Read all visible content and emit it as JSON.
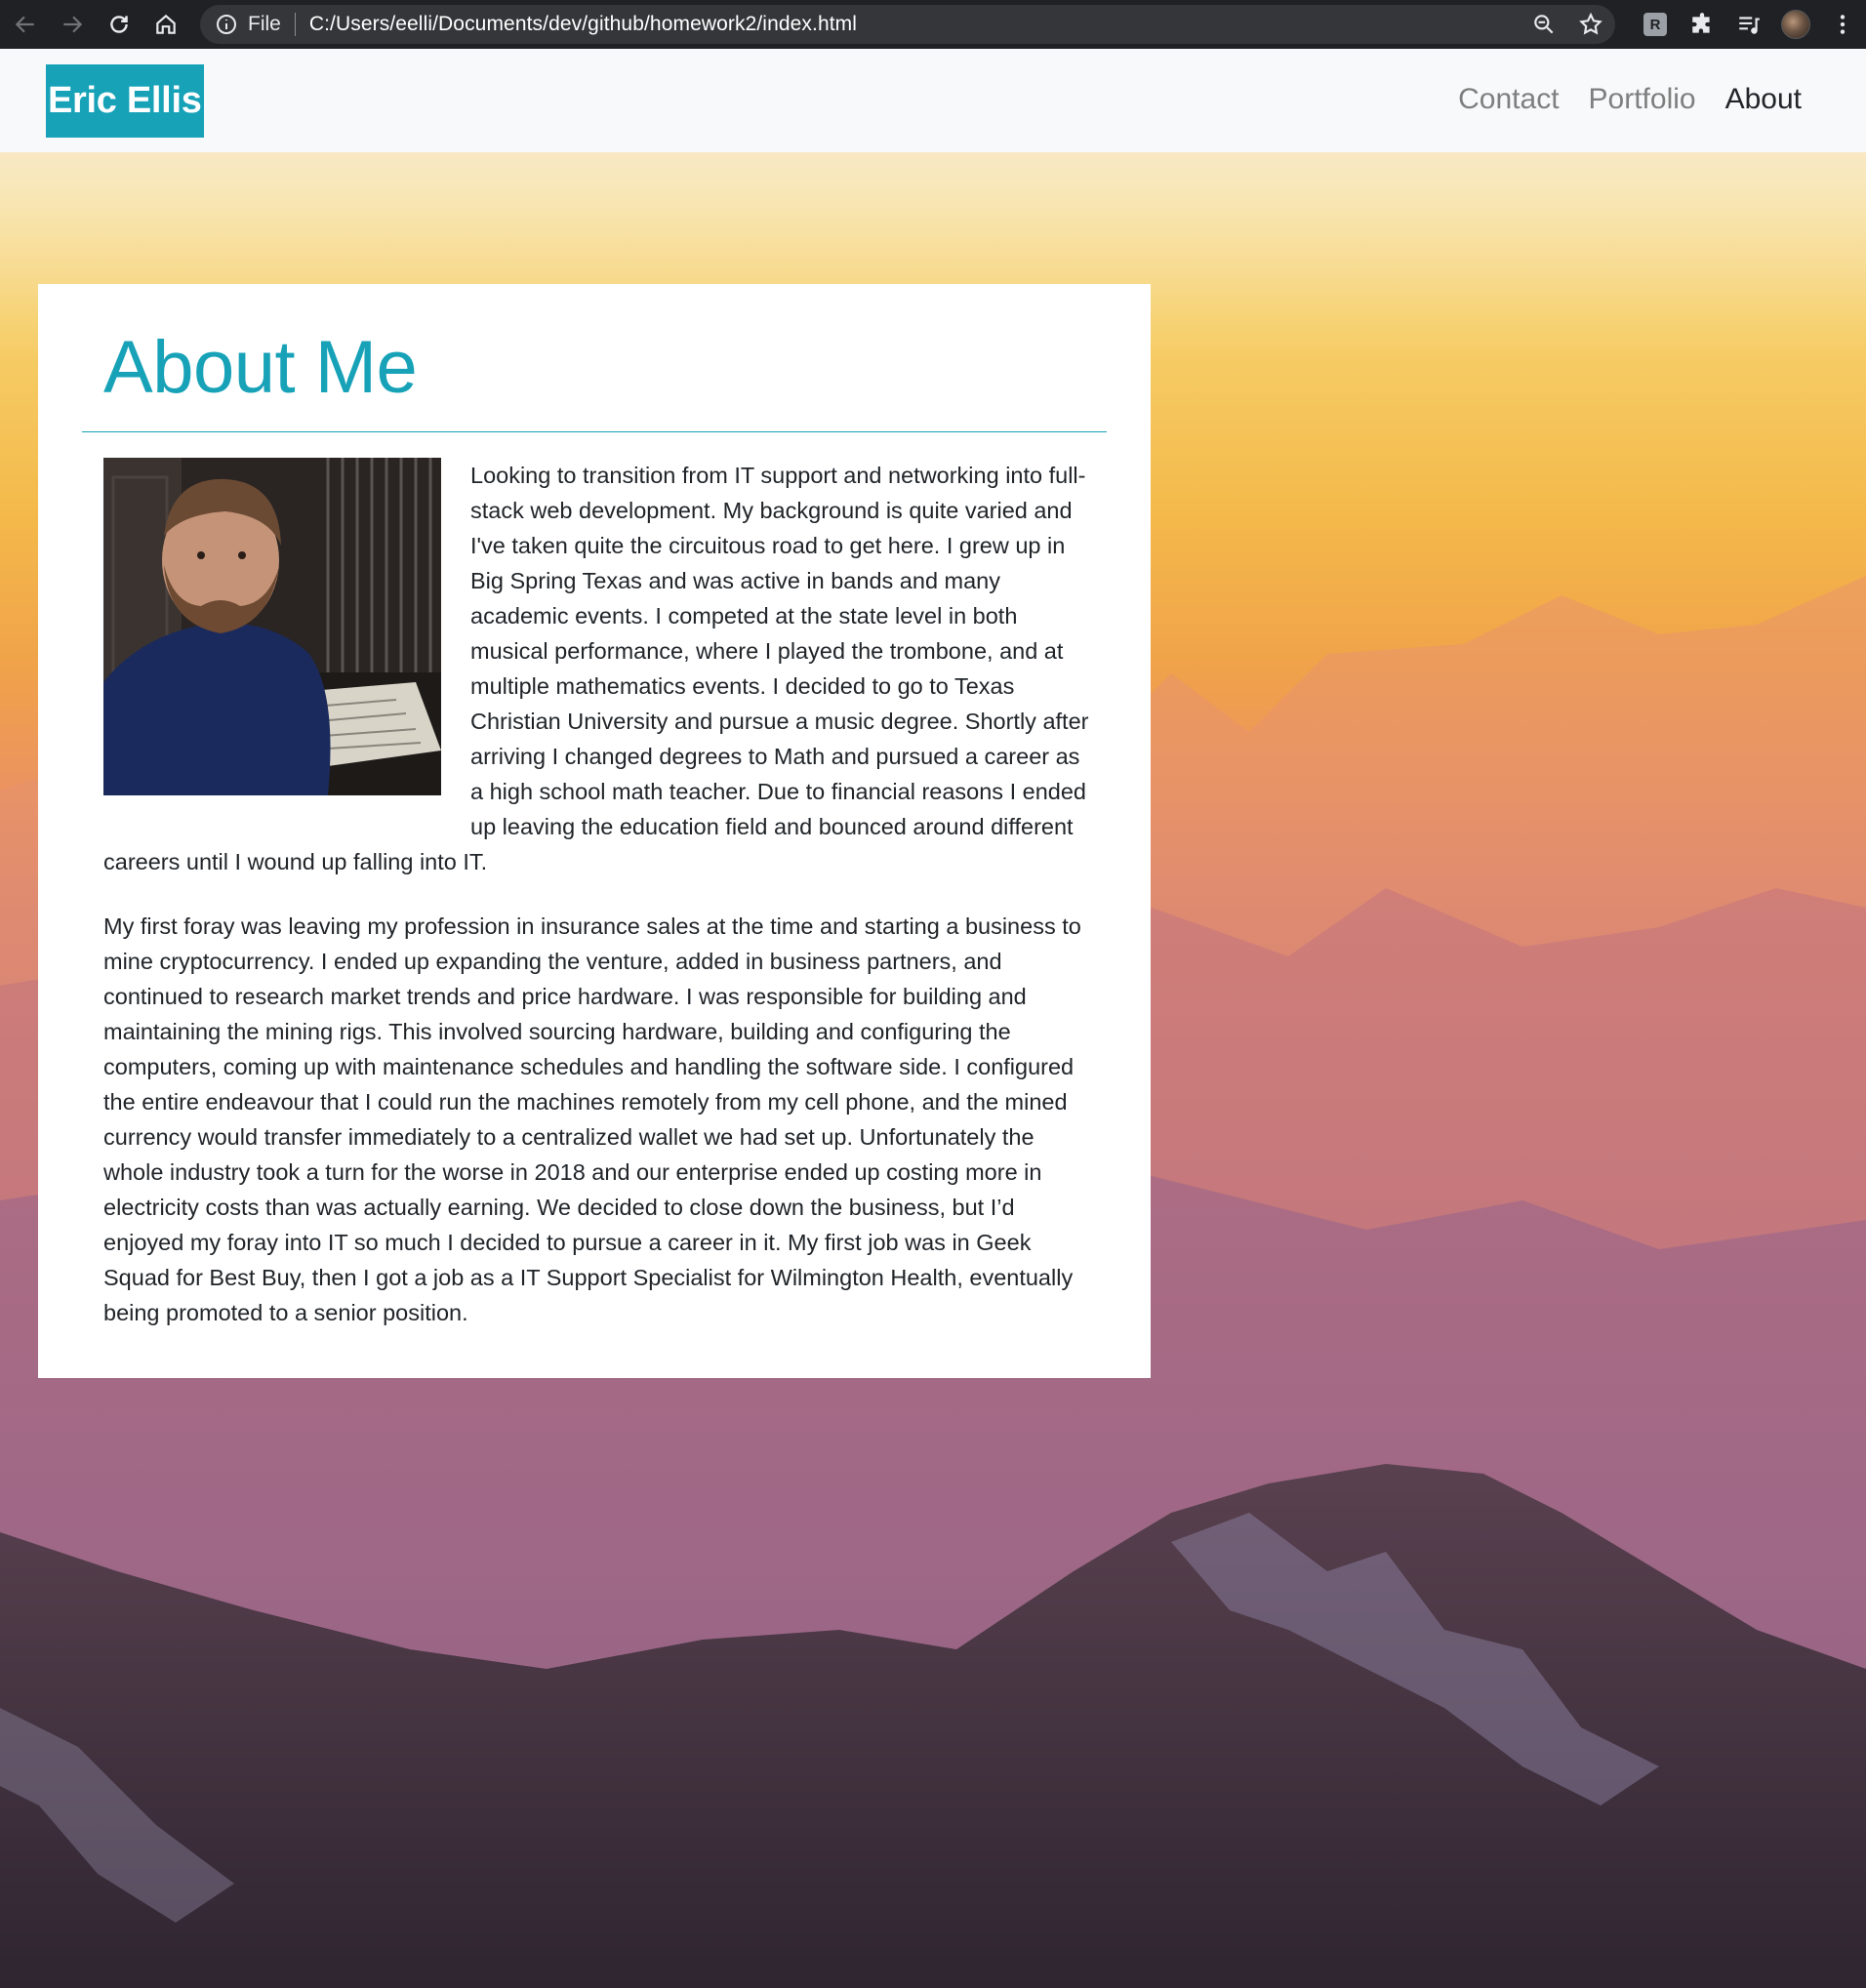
{
  "browser": {
    "scheme_label": "File",
    "url": "C:/Users/eelli/Documents/dev/github/homework2/index.html",
    "extension_badge": "R"
  },
  "site": {
    "brand": "Eric Ellis",
    "nav": [
      {
        "label": "Contact",
        "active": false
      },
      {
        "label": "Portfolio",
        "active": false
      },
      {
        "label": "About",
        "active": true
      }
    ]
  },
  "about": {
    "heading": "About Me",
    "paragraphs": [
      "Looking to transition from IT support and networking into full-stack web development. My background is quite varied and I've taken quite the circuitous road to get here. I grew up in Big Spring Texas and was active in bands and many academic events. I competed at the state level in both musical performance, where I played the trombone, and at multiple mathematics events. I decided to go to Texas Christian University and pursue a music degree. Shortly after arriving I changed degrees to Math and pursued a career as a high school math teacher. Due to financial reasons I ended up leaving the education field and bounced around different careers until I wound up falling into IT.",
      "My first foray was leaving my profession in insurance sales at the time and starting a business to mine cryptocurrency. I ended up expanding the venture, added in business partners, and continued to research market trends and price hardware. I was responsible for building and maintaining the mining rigs. This involved sourcing hardware, building and configuring the computers, coming up with maintenance schedules and handling the software side. I configured the entire endeavour that I could run the machines remotely from my cell phone, and the mined currency would transfer immediately to a centralized wallet we had set up. Unfortunately the whole industry took a turn for the worse in 2018 and our enterprise ended up costing more in electricity costs than was actually earning. We decided to close down the business, but I’d enjoyed my foray into IT so much I decided to pursue a career in it. My first job was in Geek Squad for Best Buy, then I got a job as a IT Support Specialist for Wilmington Health, eventually being promoted to a senior position."
    ]
  },
  "colors": {
    "accent": "#17a2b8",
    "nav_bg": "#f8f9fa",
    "chrome_bg": "#202124"
  }
}
